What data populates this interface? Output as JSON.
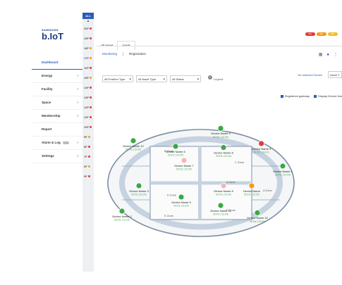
{
  "brand": {
    "small": "SAMSUNG",
    "name": "b.IoT"
  },
  "sidebar": {
    "items": [
      {
        "label": "Dashboard",
        "chev": ""
      },
      {
        "label": "Energy",
        "chev": "›"
      },
      {
        "label": "Facility",
        "chev": "›"
      },
      {
        "label": "Space",
        "chev": "›"
      },
      {
        "label": "Membership",
        "chev": "›"
      },
      {
        "label": "Report",
        "chev": ""
      },
      {
        "label": "Alarm & Log",
        "chev": "›"
      },
      {
        "label": "Settings",
        "chev": "›"
      }
    ]
  },
  "floors": {
    "all": "ALL",
    "up": "▲",
    "items": [
      {
        "label": "20F",
        "color": "#e53935"
      },
      {
        "label": "19F",
        "color": "#e53935"
      },
      {
        "label": "18F",
        "color": "#f39c12"
      },
      {
        "label": "17F",
        "color": "#f39c12"
      },
      {
        "label": "16F",
        "color": "#e53935"
      },
      {
        "label": "15F",
        "color": "#f39c12"
      },
      {
        "label": "14F",
        "color": "#e53935"
      },
      {
        "label": "13F",
        "color": "#e53935"
      },
      {
        "label": "12F",
        "color": "#e53935"
      },
      {
        "label": "11F",
        "color": "#e53935"
      },
      {
        "label": "10F",
        "color": "#e53935"
      },
      {
        "label": "9F",
        "color": "#f39c12"
      },
      {
        "label": "8F",
        "color": "#e53935"
      },
      {
        "label": "7F",
        "color": "#e53935"
      },
      {
        "label": "6F",
        "color": "#f39c12"
      },
      {
        "label": "5F",
        "color": "#e53935"
      }
    ]
  },
  "badges": [
    {
      "label": "99+",
      "color": "#e53935"
    },
    {
      "label": "99+",
      "color": "#f39c12"
    },
    {
      "label": "99+",
      "color": "#f0c020"
    }
  ],
  "tabs": [
    "All Asset",
    "Asset"
  ],
  "subtabs": [
    "Monitoring",
    "Registration"
  ],
  "filters": {
    "position_type": "All Position Type",
    "asset_type": "All Asset Type",
    "status": "All Status",
    "help": "?",
    "legend": "Legend"
  },
  "no_selected_device": "No selected Device",
  "asset_button": "Asset T",
  "checks": {
    "registered": "Registered gateway",
    "display": "Display Device Nar"
  },
  "zones": [
    "A Zone",
    "B Zone",
    "C Zone",
    "D Zone",
    "E Zone",
    "A Zone",
    "E Zone"
  ],
  "devices": [
    {
      "name": "Device Name 12",
      "reading": "25.0℃ | 23.0℃",
      "status": "ok"
    },
    {
      "name": "Device Name 6",
      "reading": "25.0℃ | 23.0℃",
      "status": "ok"
    },
    {
      "name": "Device Name 4",
      "reading": "25.0℃ | 23.0℃",
      "status": "ok"
    },
    {
      "name": "Device Name 8",
      "reading": "25.0℃ | 23.0℃",
      "status": "ok"
    },
    {
      "name": "Device Name 7",
      "reading": "25.0℃ | 23.0℃",
      "status": "offline"
    },
    {
      "name": "Device Name 3",
      "reading": "25.0℃ | 23.0℃",
      "status": "ok"
    },
    {
      "name": "Device Name 9",
      "reading": "25.0℃ | 23.0℃",
      "status": "alarm"
    },
    {
      "name": "Device Name 1",
      "reading": "25.0℃ | 23.0℃",
      "status": "ok"
    },
    {
      "name": "Device Name 5",
      "reading": "25.0℃ | 23.0℃",
      "status": "ok"
    },
    {
      "name": "Device Name 8",
      "reading": "25.0℃ | 23.0℃",
      "status": "offline"
    },
    {
      "name": "Device Name",
      "reading": "25.0℃ | 23.0℃",
      "status": "warning"
    },
    {
      "name": "Device Name 11",
      "reading": "25.0℃ | 23.0℃",
      "status": "ok"
    },
    {
      "name": "Device Name 10",
      "reading": "25.0℃ | 23.0℃",
      "status": "ok"
    },
    {
      "name": "Device Name 2",
      "reading": "25.0℃ | 23.0℃",
      "status": "ok"
    }
  ],
  "status_colors": {
    "ok": "#3aa845",
    "alarm": "#e53935",
    "warning": "#f39c12",
    "offline": "#f2b8b8"
  }
}
